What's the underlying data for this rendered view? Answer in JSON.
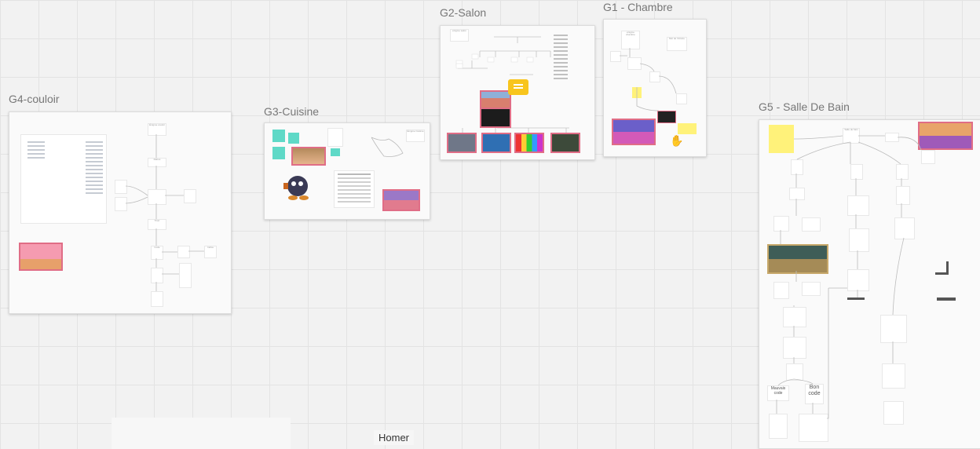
{
  "board": {
    "frames": [
      {
        "id": "g4",
        "title": "G4-couloir"
      },
      {
        "id": "g3",
        "title": "G3-Cuisine"
      },
      {
        "id": "g2",
        "title": "G2-Salon"
      },
      {
        "id": "g1",
        "title": "G1 - Chambre"
      },
      {
        "id": "g5",
        "title": "G5 - Salle De Bain"
      }
    ],
    "cursor_label": "Homer"
  },
  "g4": {
    "nodes": [
      "Énigme couloir",
      "Rébus",
      "Tiroir",
      "Code",
      "Indice"
    ]
  },
  "g3": {
    "nodes": [
      "Énigme Cuisine"
    ]
  },
  "g2": {
    "nodes": [
      "énigme salon"
    ]
  },
  "g1": {
    "nodes": [
      "énigme chambre",
      "Mot de Victoire"
    ]
  },
  "g5": {
    "nodes": [
      "Salle de bain",
      "Mauvais code",
      "Bon code"
    ]
  },
  "colors": {
    "sticky_yellow": "#fff27a",
    "sticky_teal": "#5fd9c7",
    "chat_yellow": "#f8c51d",
    "thumb_pink": "#e06d86"
  }
}
